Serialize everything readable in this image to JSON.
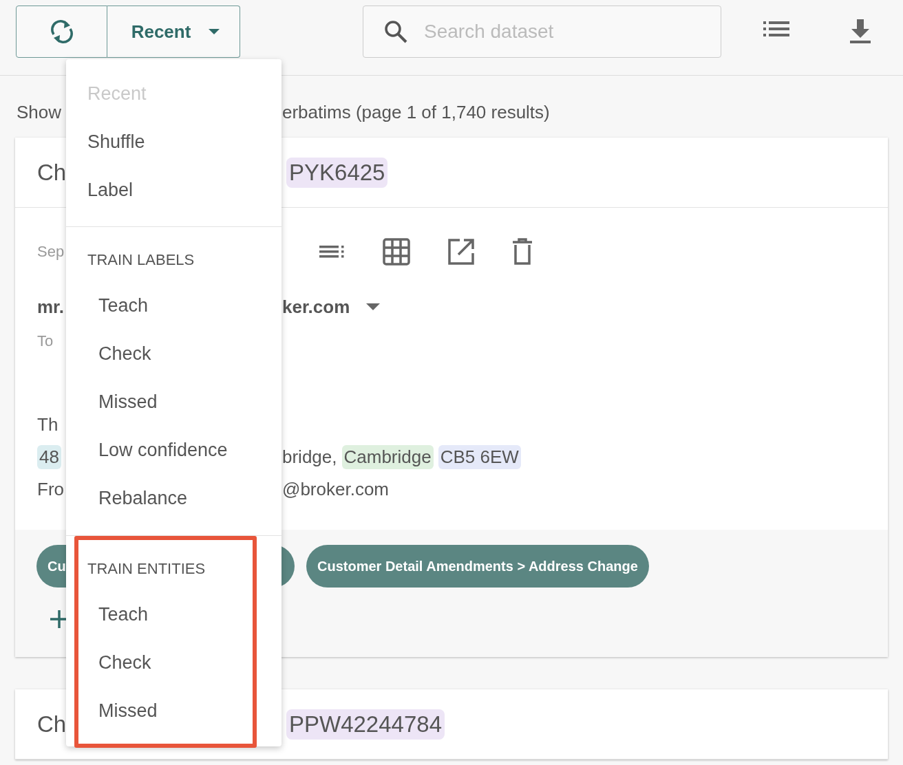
{
  "toolbar": {
    "sort_button": {
      "label": "Recent"
    },
    "search": {
      "placeholder": "Search dataset"
    }
  },
  "results_summary": {
    "start": "Show",
    "end": "erbatims (page 1 of 1,740 results)"
  },
  "cards": [
    {
      "title_start": "Ch",
      "title_tag": "PYK6425",
      "date": "Sep",
      "sender_start": "mr.",
      "sender_end": "ker.com",
      "recipient": "To",
      "body_lines": [
        {
          "start": [
            {
              "kind": "text",
              "text": "Th"
            }
          ]
        },
        {
          "start": [
            {
              "kind": "entity",
              "text": "48",
              "color": "#dbedf0"
            }
          ],
          "end": [
            {
              "kind": "text",
              "text": "bridge,"
            },
            {
              "kind": "entity",
              "text": "Cambridge",
              "color": "#dff0df"
            },
            {
              "kind": "entity",
              "text": "CB5 6EW",
              "color": "#e5e9f9"
            }
          ]
        },
        {
          "start": [
            {
              "kind": "text",
              "text": "Fro"
            }
          ],
          "end": [
            {
              "kind": "text",
              "text": "@broker.com"
            }
          ]
        }
      ],
      "labels": [
        "Cu",
        "Customer Detail Amendments > Address Change"
      ]
    },
    {
      "title_start": "Ch",
      "title_tag": "PPW42244784"
    }
  ],
  "menu": {
    "sections": [
      {
        "highlighted": false,
        "items": [
          {
            "label": "Recent",
            "disabled": true
          },
          {
            "label": "Shuffle",
            "disabled": false
          },
          {
            "label": "Label",
            "disabled": false
          }
        ]
      },
      {
        "header": "TRAIN LABELS",
        "highlighted": false,
        "items": [
          {
            "label": "Teach",
            "disabled": false
          },
          {
            "label": "Check",
            "disabled": false
          },
          {
            "label": "Missed",
            "disabled": false
          },
          {
            "label": "Low confidence",
            "disabled": false
          },
          {
            "label": "Rebalance",
            "disabled": false
          }
        ]
      },
      {
        "header": "TRAIN ENTITIES",
        "highlighted": true,
        "items": [
          {
            "label": "Teach",
            "disabled": false
          },
          {
            "label": "Check",
            "disabled": false
          },
          {
            "label": "Missed",
            "disabled": false
          }
        ]
      }
    ]
  }
}
